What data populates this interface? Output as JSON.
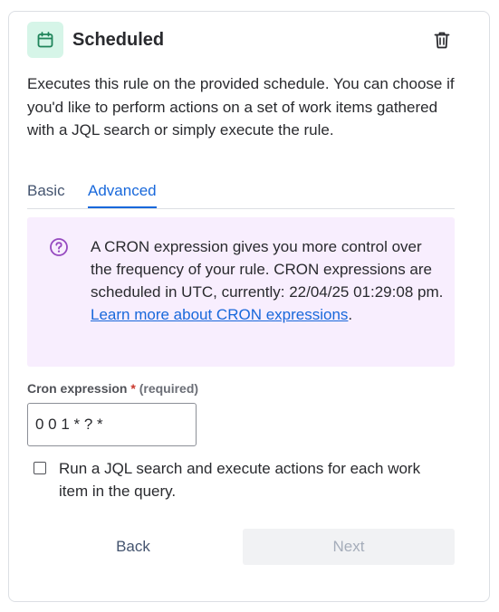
{
  "header": {
    "title": "Scheduled",
    "icon": "calendar-icon",
    "delete_icon": "trash-icon"
  },
  "description": "Executes this rule on the provided schedule. You can choose if you'd like to perform actions on a set of work items gathered with a JQL search or simply execute the rule.",
  "tabs": [
    {
      "label": "Basic",
      "selected": false
    },
    {
      "label": "Advanced",
      "selected": true
    }
  ],
  "info": {
    "icon": "question-icon",
    "text": "A CRON expression gives you more control over the frequency of your rule. CRON expressions are scheduled in UTC, currently: 22/04/25 01:29:08 pm.",
    "link_text": "Learn more about CRON expressions",
    "link_suffix": "."
  },
  "cron_field": {
    "label": "Cron expression",
    "required_marker": "*",
    "required_text": "(required)",
    "value": "0 0 1 * ? *"
  },
  "jql_checkbox": {
    "label": "Run a JQL search and execute actions for each work item in the query.",
    "checked": false
  },
  "footer": {
    "back_label": "Back",
    "next_label": "Next"
  },
  "colors": {
    "accent": "#1868db",
    "icon_tile_bg": "#d6f5e8",
    "icon_green": "#1f845a",
    "info_bg": "#f8eefe",
    "info_icon": "#964ac0",
    "required": "#c9372c",
    "disabled_bg": "#f1f2f4",
    "disabled_text": "#a5adba"
  }
}
